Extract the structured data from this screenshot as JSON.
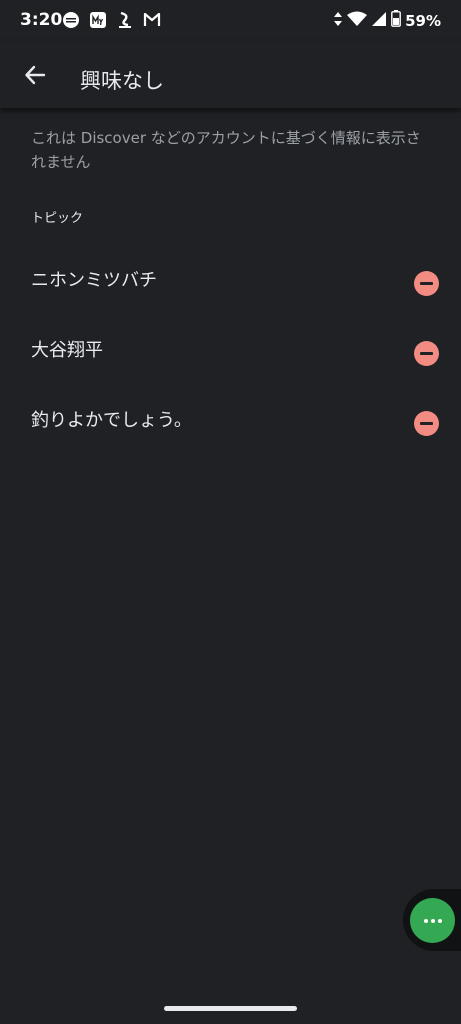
{
  "status_bar": {
    "time": "3:20",
    "battery": "59%",
    "notification_icons": [
      "app-notification-icon",
      "my-app-icon",
      "dcm-icon",
      "gmail-icon"
    ]
  },
  "app_bar": {
    "title": "興味なし"
  },
  "description": "これは Discover などのアカウントに基づく情報に表示されません",
  "section_header": "トピック",
  "topics": [
    {
      "label": "ニホンミツバチ"
    },
    {
      "label": "大谷翔平"
    },
    {
      "label": "釣りよかでしょう。"
    }
  ],
  "colors": {
    "background": "#202124",
    "remove_accent": "#f28b82",
    "bubble_accent": "#34a853"
  }
}
